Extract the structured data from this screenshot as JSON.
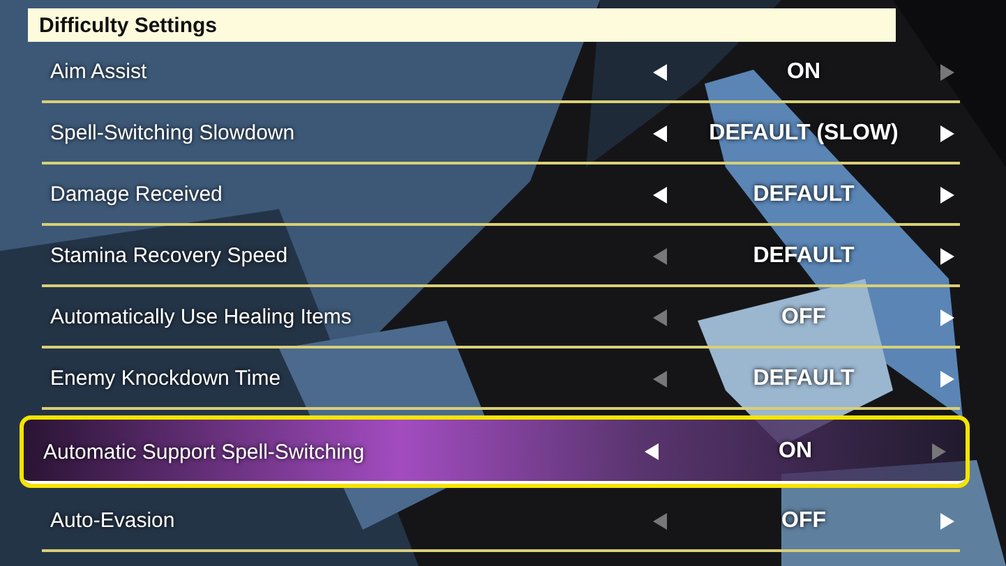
{
  "header": {
    "title": "Difficulty Settings"
  },
  "settings": [
    {
      "label": "Aim Assist",
      "value": "ON",
      "prev_enabled": true,
      "next_enabled": false,
      "selected": false
    },
    {
      "label": "Spell-Switching Slowdown",
      "value": "DEFAULT (SLOW)",
      "prev_enabled": true,
      "next_enabled": true,
      "selected": false
    },
    {
      "label": "Damage Received",
      "value": "DEFAULT",
      "prev_enabled": true,
      "next_enabled": true,
      "selected": false
    },
    {
      "label": "Stamina Recovery Speed",
      "value": "DEFAULT",
      "prev_enabled": false,
      "next_enabled": true,
      "selected": false
    },
    {
      "label": "Automatically Use Healing Items",
      "value": "OFF",
      "prev_enabled": false,
      "next_enabled": true,
      "selected": false
    },
    {
      "label": "Enemy Knockdown Time",
      "value": "DEFAULT",
      "prev_enabled": false,
      "next_enabled": true,
      "selected": false
    },
    {
      "label": "Automatic Support Spell-Switching",
      "value": "ON",
      "prev_enabled": true,
      "next_enabled": false,
      "selected": true
    },
    {
      "label": "Auto-Evasion",
      "value": "OFF",
      "prev_enabled": false,
      "next_enabled": true,
      "selected": false
    }
  ]
}
